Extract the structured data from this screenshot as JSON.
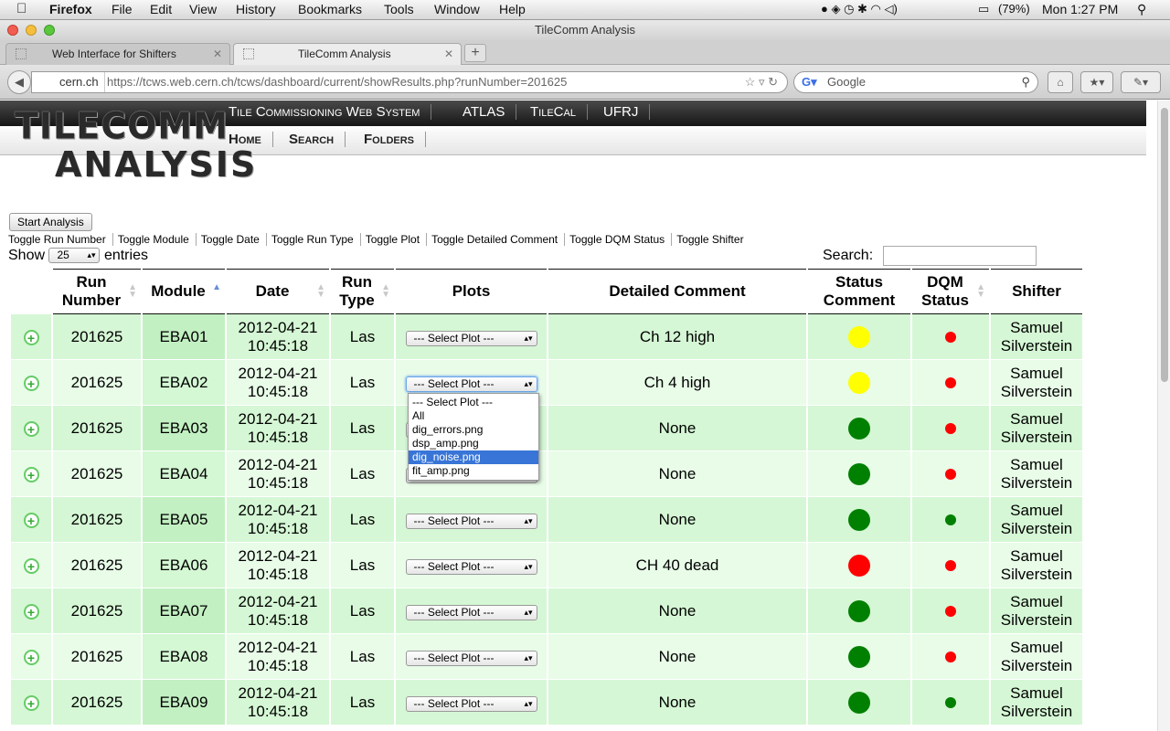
{
  "os_menu": {
    "app": "Firefox",
    "items": [
      "File",
      "Edit",
      "View",
      "History",
      "Bookmarks",
      "Tools",
      "Window",
      "Help"
    ],
    "battery": "(79%)",
    "clock": "Mon 1:27 PM"
  },
  "window": {
    "title": "TileComm Analysis"
  },
  "tabs": [
    {
      "label": "Web Interface for Shifters"
    },
    {
      "label": "TileComm Analysis"
    }
  ],
  "address": {
    "site": "cern.ch",
    "url": "https://tcws.web.cern.ch/tcws/dashboard/current/showResults.php?runNumber=201625",
    "search_placeholder": "Google"
  },
  "header": {
    "logo_line1": "TILECOMM",
    "logo_line2": "ANALYSIS",
    "top_nav": [
      "Tile Commissioning Web System",
      "ATLAS",
      "TileCal",
      "UFRJ"
    ],
    "sub_nav": [
      "Home",
      "Search",
      "Folders"
    ]
  },
  "controls": {
    "start_button": "Start Analysis",
    "toggles": [
      "Toggle Run Number",
      "Toggle Module",
      "Toggle Date",
      "Toggle Run Type",
      "Toggle Plot",
      "Toggle Detailed Comment",
      "Toggle DQM Status",
      "Toggle Shifter"
    ],
    "show_label": "Show",
    "show_value": "25",
    "entries_label": "entries",
    "search_label": "Search:"
  },
  "table": {
    "headers": [
      "Run Number",
      "Module",
      "Date",
      "Run Type",
      "Plots",
      "Detailed Comment",
      "Status Comment",
      "DQM Status",
      "Shifter"
    ],
    "select_placeholder": "--- Select Plot ---",
    "rows": [
      {
        "run": "201625",
        "module": "EBA01",
        "date": "2012-04-21",
        "time": "10:45:18",
        "type": "Las",
        "comment": "Ch 12 high",
        "status_color": "#ffff00",
        "dqm_color": "#ff0000",
        "shifter1": "Samuel",
        "shifter2": "Silverstein"
      },
      {
        "run": "201625",
        "module": "EBA02",
        "date": "2012-04-21",
        "time": "10:45:18",
        "type": "Las",
        "comment": "Ch 4 high",
        "status_color": "#ffff00",
        "dqm_color": "#ff0000",
        "shifter1": "Samuel",
        "shifter2": "Silverstein"
      },
      {
        "run": "201625",
        "module": "EBA03",
        "date": "2012-04-21",
        "time": "10:45:18",
        "type": "Las",
        "comment": "None",
        "status_color": "#008000",
        "dqm_color": "#ff0000",
        "shifter1": "Samuel",
        "shifter2": "Silverstein"
      },
      {
        "run": "201625",
        "module": "EBA04",
        "date": "2012-04-21",
        "time": "10:45:18",
        "type": "Las",
        "comment": "None",
        "status_color": "#008000",
        "dqm_color": "#ff0000",
        "shifter1": "Samuel",
        "shifter2": "Silverstein"
      },
      {
        "run": "201625",
        "module": "EBA05",
        "date": "2012-04-21",
        "time": "10:45:18",
        "type": "Las",
        "comment": "None",
        "status_color": "#008000",
        "dqm_color": "#008000",
        "shifter1": "Samuel",
        "shifter2": "Silverstein"
      },
      {
        "run": "201625",
        "module": "EBA06",
        "date": "2012-04-21",
        "time": "10:45:18",
        "type": "Las",
        "comment": "CH 40 dead",
        "status_color": "#ff0000",
        "dqm_color": "#ff0000",
        "shifter1": "Samuel",
        "shifter2": "Silverstein"
      },
      {
        "run": "201625",
        "module": "EBA07",
        "date": "2012-04-21",
        "time": "10:45:18",
        "type": "Las",
        "comment": "None",
        "status_color": "#008000",
        "dqm_color": "#ff0000",
        "shifter1": "Samuel",
        "shifter2": "Silverstein"
      },
      {
        "run": "201625",
        "module": "EBA08",
        "date": "2012-04-21",
        "time": "10:45:18",
        "type": "Las",
        "comment": "None",
        "status_color": "#008000",
        "dqm_color": "#ff0000",
        "shifter1": "Samuel",
        "shifter2": "Silverstein"
      },
      {
        "run": "201625",
        "module": "EBA09",
        "date": "2012-04-21",
        "time": "10:45:18",
        "type": "Las",
        "comment": "None",
        "status_color": "#008000",
        "dqm_color": "#008000",
        "shifter1": "Samuel",
        "shifter2": "Silverstein"
      }
    ]
  },
  "dropdown": {
    "options": [
      "--- Select Plot ---",
      "All",
      "dig_errors.png",
      "dsp_amp.png",
      "dig_noise.png",
      "fit_amp.png"
    ],
    "highlighted": "dig_noise.png"
  }
}
